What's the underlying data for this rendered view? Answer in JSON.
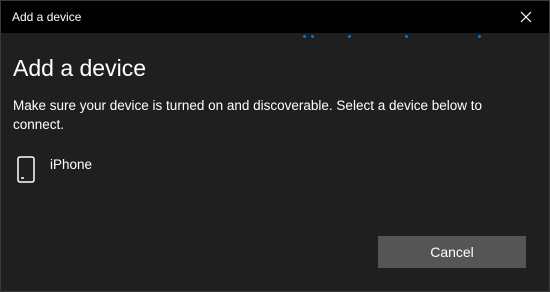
{
  "window": {
    "title": "Add a device"
  },
  "colors": {
    "accent": "#0078d7",
    "titlebar": "#000000",
    "background": "#1f1f1f",
    "button": "#555555",
    "text": "#ffffff"
  },
  "icons": {
    "close": "close-icon",
    "device": "phone-icon"
  },
  "content": {
    "heading": "Add a device",
    "description": "Make sure your device is turned on and discoverable. Select a device below to connect.",
    "devices": [
      {
        "name": "iPhone",
        "icon": "phone-icon"
      }
    ]
  },
  "actions": {
    "cancel_label": "Cancel"
  }
}
